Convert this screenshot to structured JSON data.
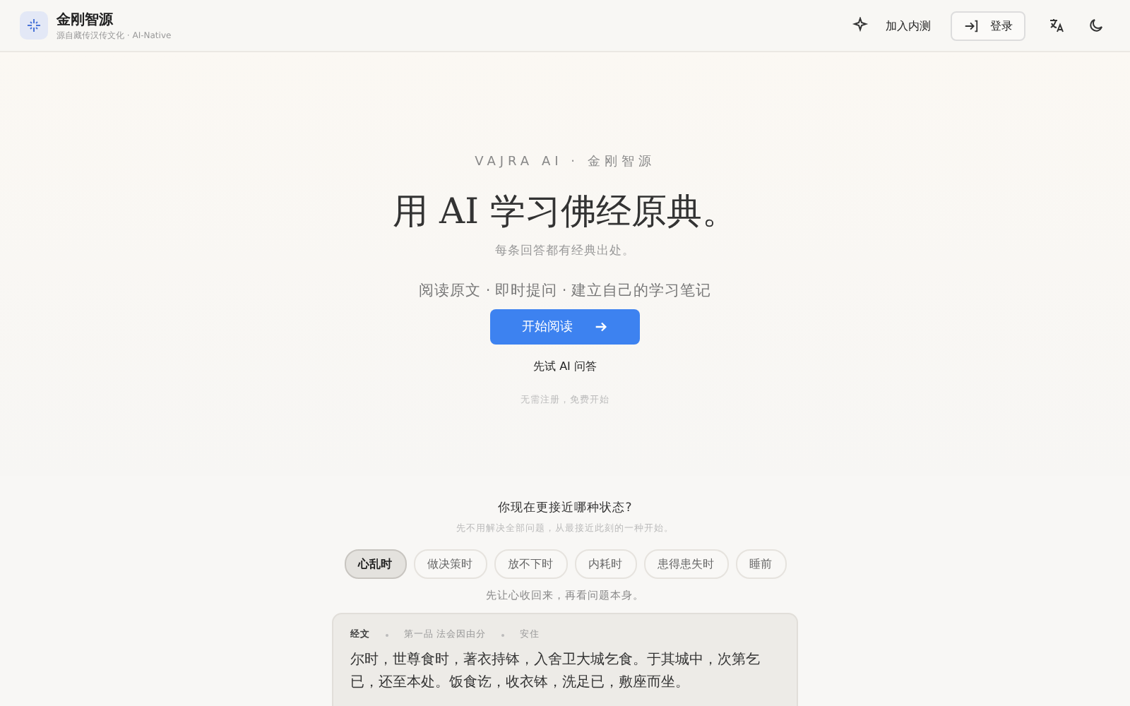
{
  "header": {
    "brand": "金刚智源",
    "tagline": "源自藏传汉传文化 · AI-Native",
    "beta": "加入内测",
    "login": "登录"
  },
  "hero": {
    "eyebrow": "VAJRA AI · 金刚智源",
    "title": "用 AI 学习佛经原典。",
    "subtitle": "每条回答都有经典出处。",
    "features": "阅读原文 · 即时提问 · 建立自己的学习笔记",
    "cta": "开始阅读",
    "secondary": "先试 AI 问答",
    "note": "无需注册，免费开始"
  },
  "states": {
    "question": "你现在更接近哪种状态?",
    "hint": "先不用解决全部问题，从最接近此刻的一种开始。",
    "chips": [
      {
        "label": "心乱时",
        "selected": true
      },
      {
        "label": "做决策时",
        "selected": false
      },
      {
        "label": "放不下时",
        "selected": false
      },
      {
        "label": "内耗时",
        "selected": false
      },
      {
        "label": "患得患失时",
        "selected": false
      },
      {
        "label": "睡前",
        "selected": false
      }
    ],
    "advice": "先让心收回来，再看问题本身。"
  },
  "scripture": {
    "tag": "经文",
    "chapter": "第一品 法会因由分",
    "theme": "安住",
    "text": "尔时，世尊食时，著衣持钵，入舍卫大城乞食。于其城中，次第乞已，还至本处。饭食讫，收衣钵，洗足已，敷座而坐。"
  }
}
